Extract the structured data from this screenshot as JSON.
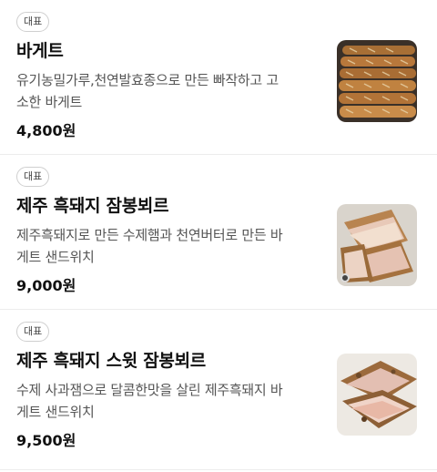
{
  "menu": {
    "items": [
      {
        "badge": "대표",
        "name": "바게트",
        "desc": "유기농밀가루,천연발효종으로 만든 빠작하고 고소한 바게트",
        "price": "4,800원",
        "image": "baguette-photo"
      },
      {
        "badge": "대표",
        "name": "제주 흑돼지 잠봉뵈르",
        "desc": "제주흑돼지로 만든 수제햄과 천연버터로 만든 바게트 샌드위치",
        "price": "9,000원",
        "image": "sandwich-photo"
      },
      {
        "badge": "대표",
        "name": "제주 흑돼지 스윗 잠봉뵈르",
        "desc": "수제 사과잼으로 달콤한맛을 살린 제주흑돼지 바게트 샌드위치",
        "price": "9,500원",
        "image": "sweet-sandwich-photo"
      }
    ]
  }
}
